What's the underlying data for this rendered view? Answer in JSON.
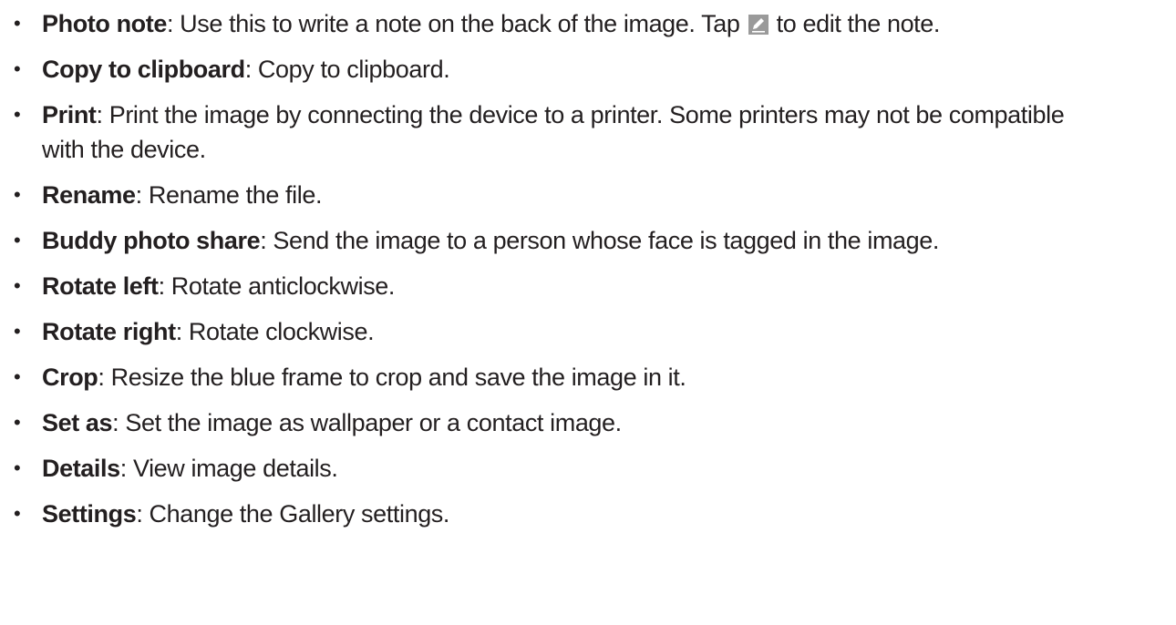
{
  "items": [
    {
      "term": "Photo note",
      "before_icon": ": Use this to write a note on the back of the image. Tap ",
      "icon": "edit-icon",
      "after_icon": " to edit the note."
    },
    {
      "term": "Copy to clipboard",
      "desc": ": Copy to clipboard."
    },
    {
      "term": "Print",
      "desc": ": Print the image by connecting the device to a printer. Some printers may not be compatible with the device."
    },
    {
      "term": "Rename",
      "desc": ": Rename the file."
    },
    {
      "term": "Buddy photo share",
      "desc": ": Send the image to a person whose face is tagged in the image."
    },
    {
      "term": "Rotate left",
      "desc": ": Rotate anticlockwise."
    },
    {
      "term": "Rotate right",
      "desc": ": Rotate clockwise."
    },
    {
      "term": "Crop",
      "desc": ": Resize the blue frame to crop and save the image in it."
    },
    {
      "term": "Set as",
      "desc": ": Set the image as wallpaper or a contact image."
    },
    {
      "term": "Details",
      "desc": ": View image details."
    },
    {
      "term": "Settings",
      "desc": ": Change the Gallery settings."
    }
  ],
  "bullet_char": "•"
}
